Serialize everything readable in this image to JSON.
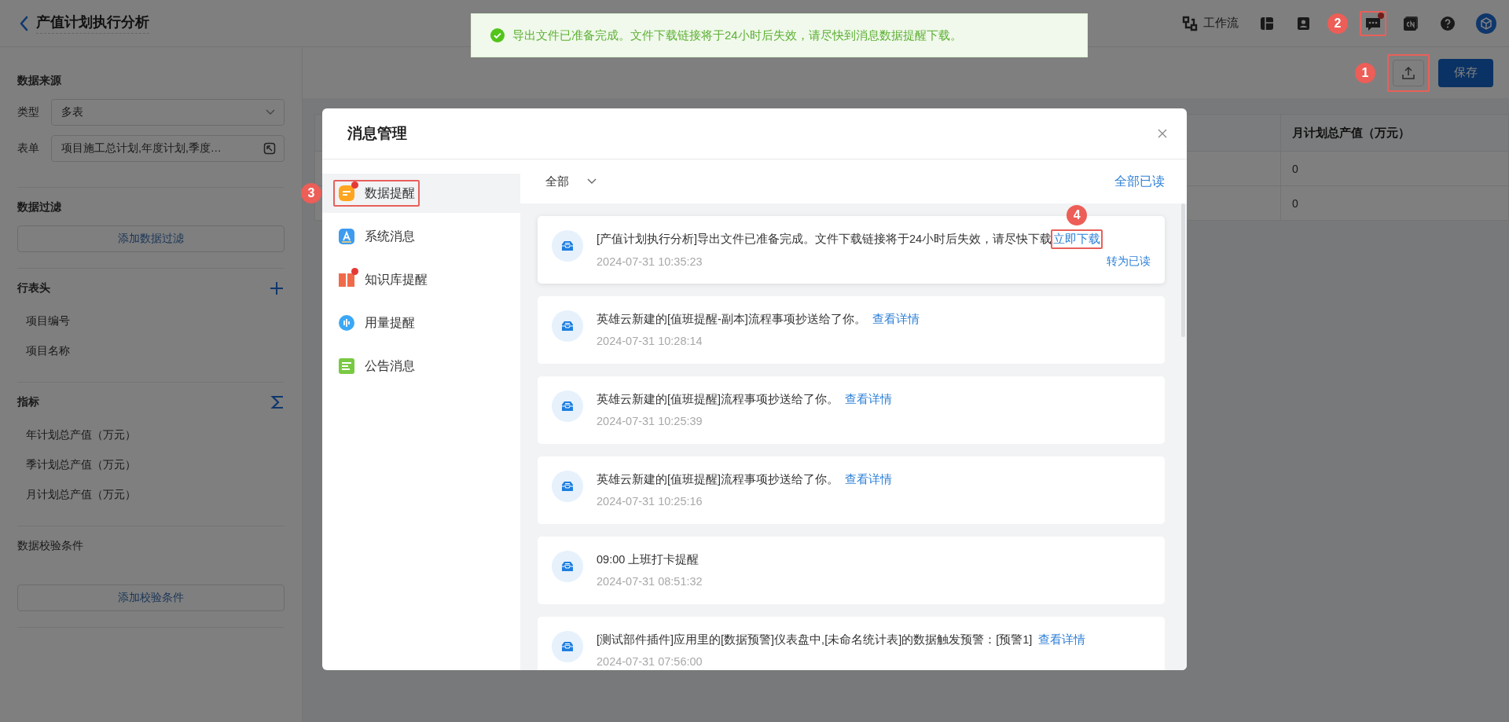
{
  "header": {
    "title": "产值计划执行分析",
    "tools": [
      {
        "kind": "workflow",
        "label": "工作流"
      },
      {
        "kind": "layout"
      },
      {
        "kind": "contacts"
      },
      {
        "kind": "messages",
        "unread": true,
        "callout": {
          "label": "2",
          "kind": "left"
        }
      },
      {
        "kind": "language"
      },
      {
        "kind": "help"
      },
      {
        "kind": "avatar"
      }
    ]
  },
  "toast": {
    "message": "导出文件已准备完成。文件下载链接将于24小时后失效，请尽快到消息数据提醒下载。"
  },
  "toolbar": {
    "export_callout": {
      "label": "1",
      "kind": "left"
    },
    "save": "保存"
  },
  "sidebar": {
    "sections": [
      {
        "kind": "fields",
        "title": "数据来源",
        "emphasized": true,
        "fields": [
          {
            "label": "类型",
            "kind": "select",
            "value": "多表"
          },
          {
            "label": "表单",
            "kind": "picker",
            "value": "项目施工总计划,年度计划,季度…"
          }
        ]
      },
      {
        "kind": "button",
        "title": "数据过滤",
        "emphasized": true,
        "button": "添加数据过滤"
      },
      {
        "kind": "add_list",
        "title": "行表头",
        "emphasized": true,
        "items": [
          "项目编号",
          "项目名称"
        ]
      },
      {
        "kind": "sum_list",
        "title": "指标",
        "emphasized": true,
        "items": [
          "年计划总产值（万元）",
          "季计划总产值（万元）",
          "月计划总产值（万元）"
        ]
      },
      {
        "kind": "button",
        "title": "数据校验条件",
        "emphasized": false,
        "button": "添加校验条件"
      }
    ]
  },
  "table": {
    "columns": [
      "月计划总产值（万元）"
    ],
    "rows": [
      [
        "0"
      ],
      [
        "0"
      ]
    ]
  },
  "modal": {
    "title": "消息管理",
    "categories": [
      {
        "kind": "data",
        "label": "数据提醒",
        "selected": true,
        "unread": true,
        "callout": {
          "label": "3",
          "kind": "left"
        }
      },
      {
        "kind": "system",
        "label": "系统消息",
        "selected": false,
        "unread": false
      },
      {
        "kind": "knowledge",
        "label": "知识库提醒",
        "selected": false,
        "unread": true
      },
      {
        "kind": "usage",
        "label": "用量提醒",
        "selected": false,
        "unread": false
      },
      {
        "kind": "notice",
        "label": "公告消息",
        "selected": false,
        "unread": false
      }
    ],
    "filter": "全部",
    "mark_all_read": "全部已读",
    "messages": [
      {
        "text": "[产值计划执行分析]导出文件已准备完成。文件下载链接将于24小时后失效，请尽快下载",
        "link": "立即下载",
        "time": "2024-07-31 10:35:23",
        "action": "转为已读",
        "callout": {
          "label": "4",
          "kind": "top"
        }
      },
      {
        "text": "英雄云新建的[值班提醒-副本]流程事项抄送给了你。",
        "link": "查看详情",
        "time": "2024-07-31 10:28:14"
      },
      {
        "text": "英雄云新建的[值班提醒]流程事项抄送给了你。",
        "link": "查看详情",
        "time": "2024-07-31 10:25:39"
      },
      {
        "text": "英雄云新建的[值班提醒]流程事项抄送给了你。",
        "link": "查看详情",
        "time": "2024-07-31 10:25:16"
      },
      {
        "text": "09:00 上班打卡提醒",
        "time": "2024-07-31 08:51:32"
      },
      {
        "text": "[测试部件插件]应用里的[数据预警]仪表盘中,[未命名统计表]的数据触发预警：[预警1]",
        "link": "查看详情",
        "time": "2024-07-31 07:56:00"
      }
    ]
  }
}
